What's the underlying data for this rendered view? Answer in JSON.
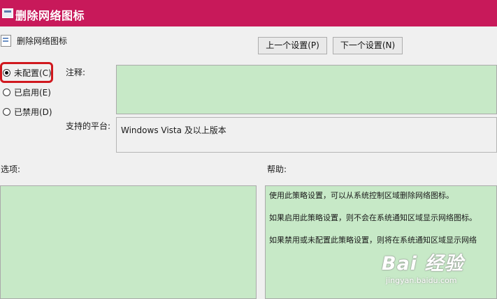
{
  "window": {
    "title": "删除网络图标"
  },
  "policy": {
    "name": "删除网络图标"
  },
  "nav": {
    "prev_label": "上一个设置(P)",
    "next_label": "下一个设置(N)"
  },
  "state_options": [
    {
      "label": "未配置(C)",
      "selected": true
    },
    {
      "label": "已启用(E)",
      "selected": false
    },
    {
      "label": "已禁用(D)",
      "selected": false
    }
  ],
  "comment": {
    "label": "注释:",
    "value": ""
  },
  "platform": {
    "label": "支持的平台:",
    "value": "Windows Vista 及以上版本"
  },
  "options": {
    "label": "选项:"
  },
  "help": {
    "label": "帮助:",
    "lines": [
      "使用此策略设置，可以从系统控制区域删除网络图标。",
      "如果启用此策略设置，则不会在系统通知区域显示网络图标。",
      "如果禁用或未配置此策略设置，则将在系统通知区域显示网络"
    ]
  },
  "watermark": {
    "brand": "Bai 经验",
    "url": "jingyan.baidu.com"
  },
  "colors": {
    "titlebar": "#c8195a",
    "field_bg": "#c7e9c7",
    "highlight": "#d0181e"
  }
}
